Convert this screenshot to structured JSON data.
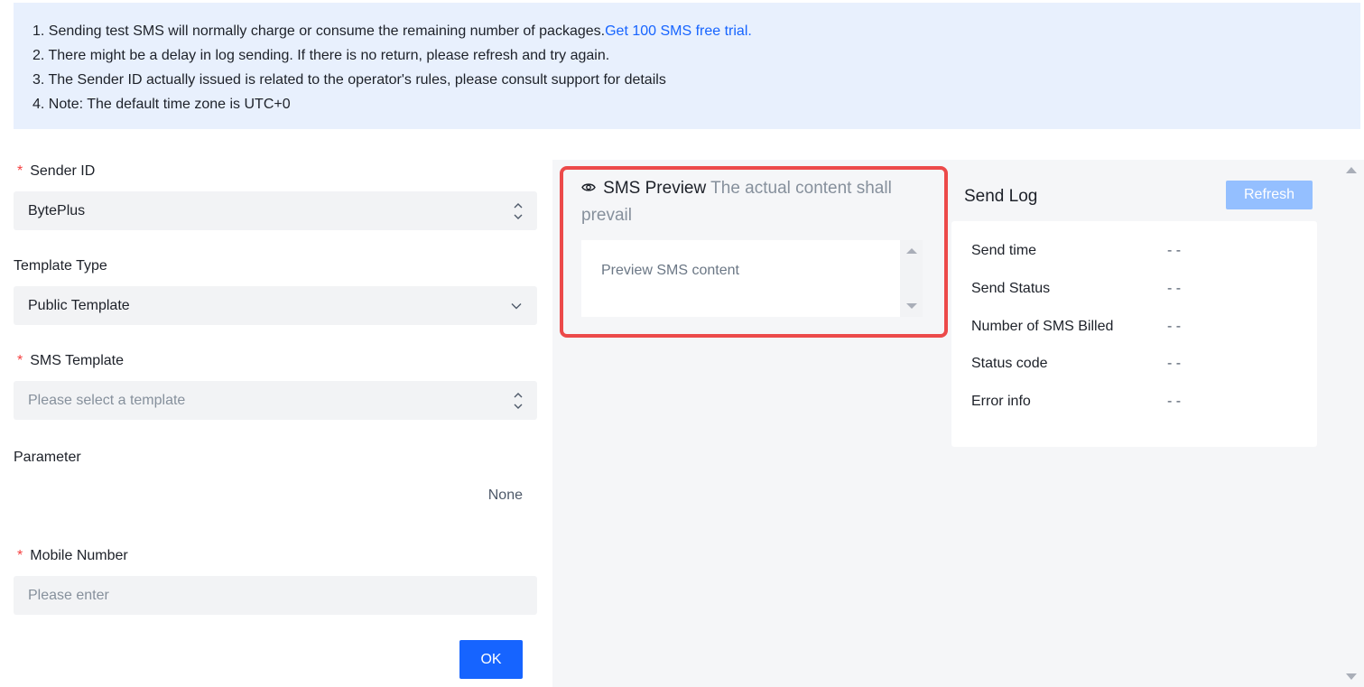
{
  "notice": {
    "line1": "1. Sending test SMS will normally charge or consume the remaining number of packages.",
    "line1_link": "Get 100 SMS free trial.",
    "line2": "2. There might be a delay in log sending. If there is no return, please refresh and try again.",
    "line3": "3. The Sender ID actually issued is related to the operator's rules, please consult support for details",
    "line4": "4. Note: The default time zone is UTC+0"
  },
  "form": {
    "required_mark": "*",
    "sender_id": {
      "label": "Sender ID",
      "value": "BytePlus"
    },
    "template_type": {
      "label": "Template Type",
      "value": "Public Template"
    },
    "sms_template": {
      "label": "SMS Template",
      "placeholder": "Please select a template"
    },
    "parameter": {
      "label": "Parameter",
      "value": "None"
    },
    "mobile_number": {
      "label": "Mobile Number",
      "placeholder": "Please enter"
    },
    "ok_label": "OK"
  },
  "preview": {
    "title": "SMS Preview",
    "subtitle": "The actual content shall prevail",
    "content_placeholder": "Preview SMS content"
  },
  "send_log": {
    "title": "Send Log",
    "refresh_label": "Refresh",
    "rows": [
      {
        "label": "Send time",
        "value": "- -"
      },
      {
        "label": "Send Status",
        "value": "- -"
      },
      {
        "label": "Number of SMS Billed",
        "value": "- -"
      },
      {
        "label": "Status code",
        "value": "- -"
      },
      {
        "label": "Error info",
        "value": "- -"
      }
    ]
  },
  "icons": {
    "updown": "updown-chevron-icon",
    "chevron": "chevron-down-icon",
    "eye": "eye-icon"
  },
  "colors": {
    "accent": "#1664ff",
    "required": "#f53f3f",
    "highlight_border": "#ec4a4a",
    "notice_bg": "#e8f0fd"
  }
}
